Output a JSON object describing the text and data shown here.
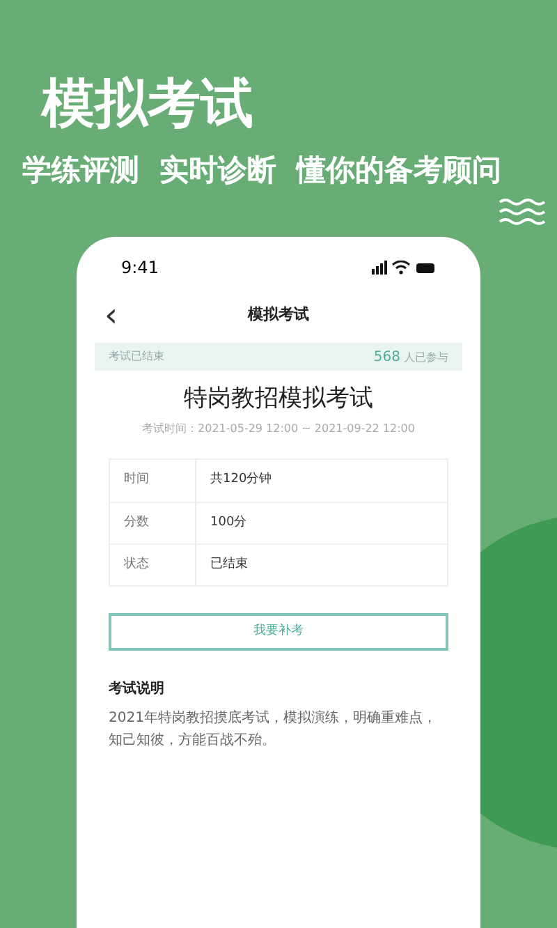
{
  "promo": {
    "headline": "模拟考试",
    "tagline": "学练评测  实时诊断  懂你的备考顾问"
  },
  "status_bar": {
    "time": "9:41"
  },
  "nav": {
    "back": "‹",
    "title": "模拟考试"
  },
  "banner": {
    "status": "考试已结束",
    "count": "568",
    "count_suffix": " 人已参与"
  },
  "exam": {
    "title": "特岗教招模拟考试",
    "period": "考试时间：2021-05-29 12:00 ~ 2021-09-22 12:00"
  },
  "table": {
    "rows": [
      {
        "label": "时间",
        "value": "共120分钟"
      },
      {
        "label": "分数",
        "value": "100分"
      },
      {
        "label": "状态",
        "value": "已结束"
      }
    ]
  },
  "action_button": "我要补考",
  "description": {
    "heading": "考试说明",
    "text": "2021年特岗教招摸底考试，模拟演练，明确重难点，知己知彼，方能百战不殆。"
  }
}
